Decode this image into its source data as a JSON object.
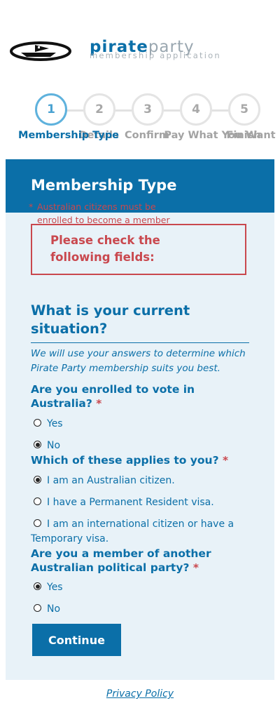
{
  "logo": {
    "name_bold": "pirate",
    "name_thin": "party",
    "subtitle": "membership application",
    "alt": "Pirate Party"
  },
  "steps": [
    {
      "number": "1",
      "label": "Membership Type",
      "active": true
    },
    {
      "number": "2",
      "label": "Details",
      "active": false
    },
    {
      "number": "3",
      "label": "Confirm",
      "active": false
    },
    {
      "number": "4",
      "label": "Pay What You Want",
      "active": false
    },
    {
      "number": "5",
      "label": "Finish",
      "active": false
    }
  ],
  "card": {
    "title": "Membership Type",
    "error": {
      "title": "Please check the following fields:",
      "items": [
        "Australian citizens must be enrolled to become a member"
      ]
    },
    "section_title": "What is your current situation?",
    "intro": "We will use your answers to determine which Pirate Party membership suits you best.",
    "questions": [
      {
        "label": "Are you enrolled to vote in Australia?",
        "required_mark": "*",
        "options": [
          {
            "label": "Yes",
            "checked": false
          },
          {
            "label": "No",
            "checked": true
          }
        ]
      },
      {
        "label": "Which of these applies to you?",
        "required_mark": "*",
        "options": [
          {
            "label": "I am an Australian citizen.",
            "checked": true
          },
          {
            "label": "I have a Permanent Resident visa.",
            "checked": false
          },
          {
            "label": "I am an international citizen or have a Temporary visa.",
            "checked": false
          }
        ]
      },
      {
        "label": "Are you a member of another Australian political party?",
        "required_mark": "*",
        "options": [
          {
            "label": "Yes",
            "checked": true
          },
          {
            "label": "No",
            "checked": false
          }
        ]
      }
    ],
    "continue_label": "Continue"
  },
  "footer": {
    "privacy_label": "Privacy Policy"
  },
  "colors": {
    "brand_blue": "#0b6fa8",
    "error_red": "#c9484e",
    "card_background": "#e8f2f8",
    "step_active_ring": "#5fb2dd"
  }
}
